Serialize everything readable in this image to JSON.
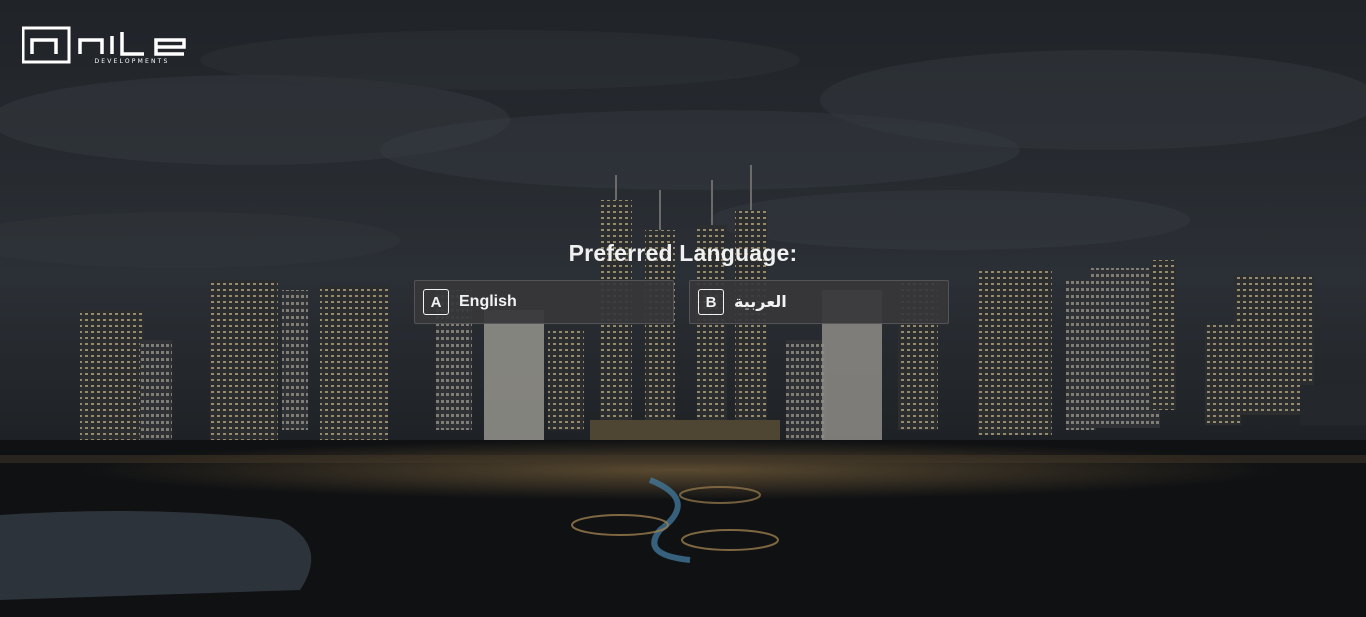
{
  "brand": {
    "name": "nile",
    "tagline": "DEVELOPMENTS"
  },
  "prompt": {
    "title": "Preferred Language:"
  },
  "options": [
    {
      "key": "A",
      "label": "English"
    },
    {
      "key": "B",
      "label": "العربية"
    }
  ],
  "colors": {
    "text": "#f2f2f2",
    "option_bg": "#37373a",
    "sky": "#2a3038"
  }
}
